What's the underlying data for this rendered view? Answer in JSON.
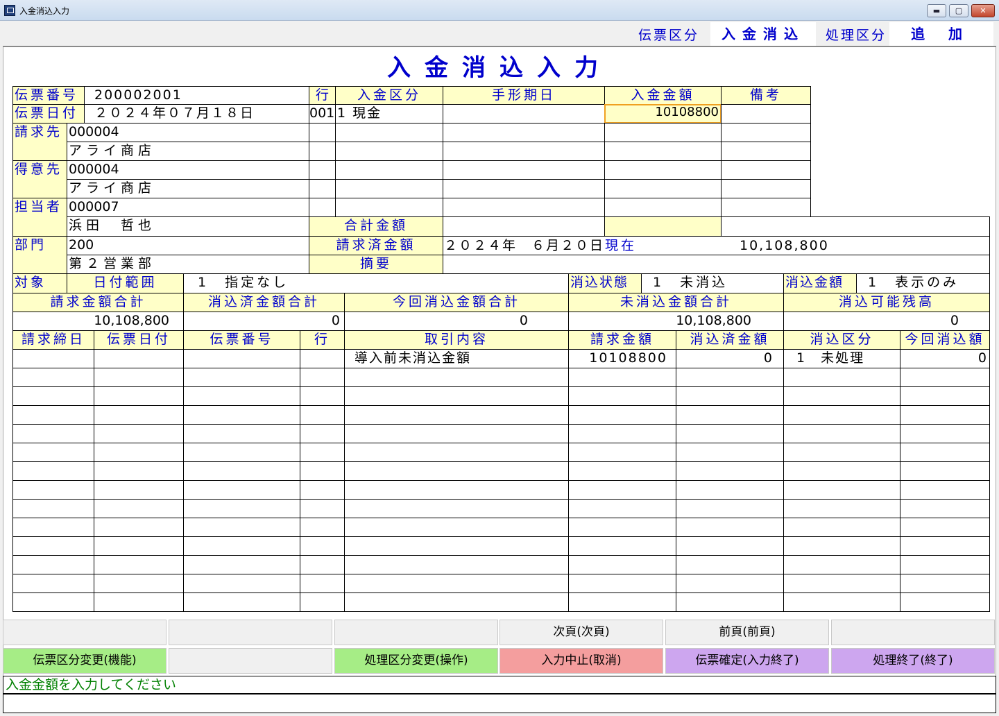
{
  "window": {
    "title": "入金消込入力",
    "min_label": "▬",
    "max_label": "▢",
    "close_label": "✕"
  },
  "header": {
    "denpyo_kubun_label": "伝票区分",
    "denpyo_kubun_value": "入金消込",
    "shori_kubun_label": "処理区分",
    "shori_kubun_value": "追加"
  },
  "title": "入金消込入力",
  "left": {
    "denpyo_no_label": "伝票番号",
    "denpyo_no_value": "200002001",
    "denpyo_date_label": "伝票日付",
    "denpyo_date_value": "２０２４年０７月１８日",
    "seikyu_label": "請求先",
    "seikyu_code": "000004",
    "seikyu_name": "アライ商店",
    "tokui_label": "得意先",
    "tokui_code": "000004",
    "tokui_name": "アライ商店",
    "tanto_label": "担当者",
    "tanto_code": "000007",
    "tanto_name": "浜田　哲也",
    "bumon_label": "部門",
    "bumon_code": "200",
    "bumon_name": "第２営業部"
  },
  "lines": {
    "headers": {
      "row": "行",
      "nyukin_kubun": "入金区分",
      "tegata_date": "手形期日",
      "nyukin_amount": "入金金額",
      "biko": "備考"
    },
    "rows": [
      {
        "row": "001",
        "nyukin_kubun": "1 現金",
        "tegata_date": "",
        "nyukin_amount": "10108800",
        "biko": ""
      }
    ],
    "goukei_label": "合計金額",
    "seikyuzumi_label": "請求済金額",
    "seikyuzumi_date": "２０２４年　６月２０日",
    "seikyuzumi_genzai": "現在",
    "seikyuzumi_amount": "10,108,800",
    "tekiyo_label": "摘要"
  },
  "filter": {
    "taisho_label": "対象",
    "date_range_label": "日付範囲",
    "date_range_value": "1　指定なし",
    "keshikomi_state_label": "消込状態",
    "keshikomi_state_value": "1　未消込",
    "keshikomi_amount_label": "消込金額",
    "keshikomi_amount_value": "1　表示のみ"
  },
  "totals": {
    "headers": [
      "請求金額合計",
      "消込済金額合計",
      "今回消込金額合計",
      "未消込金額合計",
      "消込可能残高"
    ],
    "values": [
      "10,108,800",
      "0",
      "0",
      "10,108,800",
      "0"
    ]
  },
  "detail": {
    "headers": [
      "請求締日",
      "伝票日付",
      "伝票番号",
      "行",
      "取引内容",
      "請求金額",
      "消込済金額",
      "消込区分",
      "今回消込額"
    ],
    "rows": [
      [
        "",
        "",
        "",
        "",
        "導入前未消込金額",
        "10108800",
        "0",
        "1　未処理",
        "0"
      ]
    ]
  },
  "buttons": {
    "row1": [
      "",
      "",
      "",
      "次頁(次頁)",
      "前頁(前頁)",
      ""
    ],
    "row2": [
      "伝票区分変更(機能)",
      "",
      "処理区分変更(操作)",
      "入力中止(取消)",
      "伝票確定(入力終了)",
      "処理終了(終了)"
    ]
  },
  "status_message": "入金金額を入力してください"
}
